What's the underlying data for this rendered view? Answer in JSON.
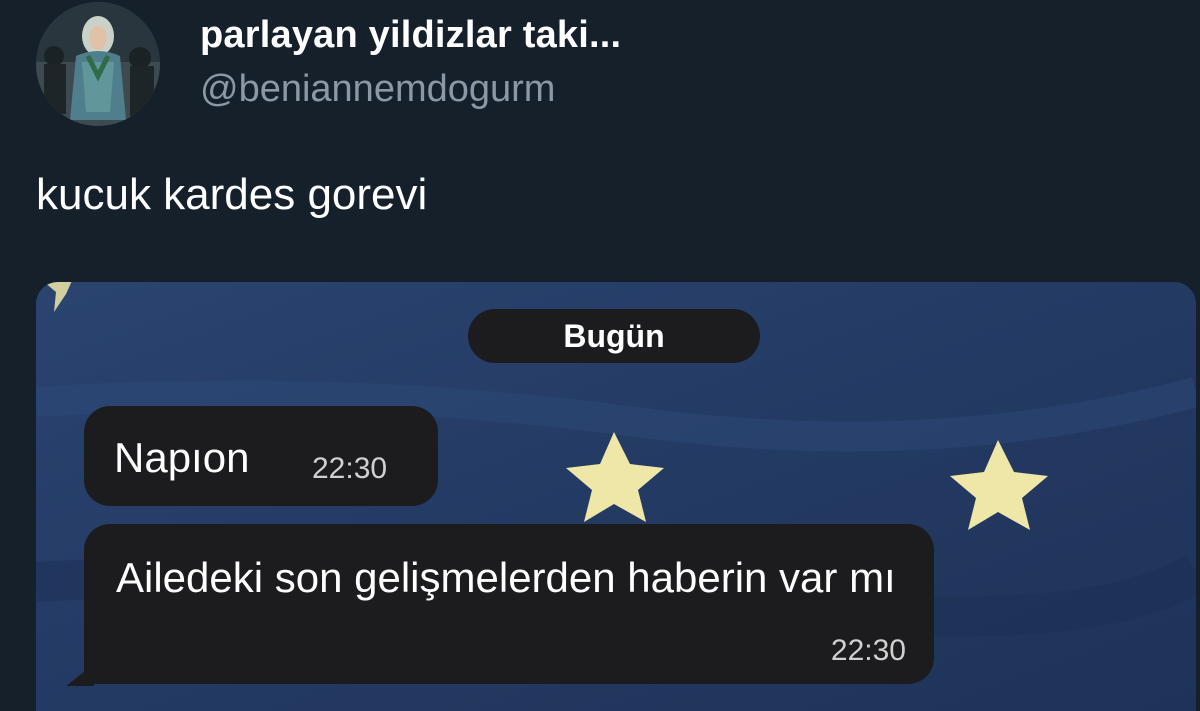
{
  "author": {
    "display_name": "parlayan yildizlar taki...",
    "handle": "@beniannemdogurm"
  },
  "tweet": {
    "text": "kucuk kardes gorevi"
  },
  "chat": {
    "date_label": "Bugün",
    "messages": [
      {
        "text": "Napıon",
        "time": "22:30"
      },
      {
        "text": "Ailedeki son gelişmelerden haberin var mı",
        "time": "22:30"
      }
    ]
  },
  "colors": {
    "background": "#15202b",
    "wallpaper": "#243a5e",
    "star": "#efe7a8",
    "bubble": "#1c1c1e"
  }
}
